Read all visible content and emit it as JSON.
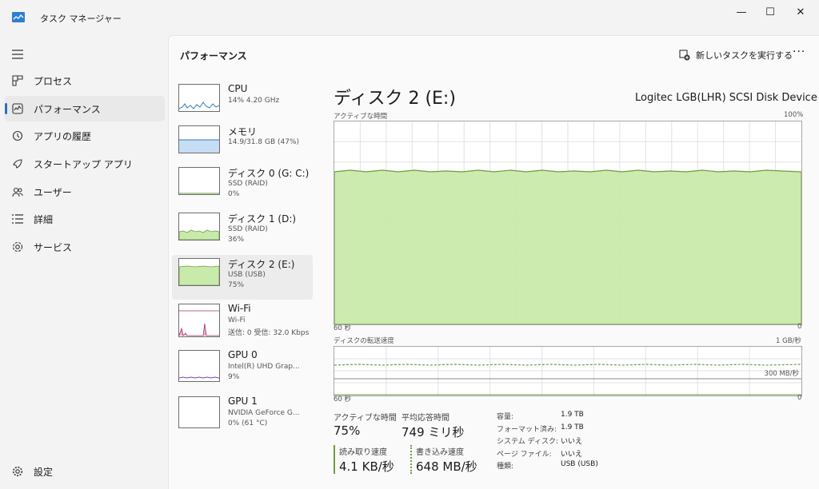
{
  "window": {
    "title": "タスク マネージャー",
    "controls": {
      "minimize": "—",
      "maximize": "☐",
      "close": "✕"
    }
  },
  "sidebar": {
    "menu_icon": "hamburger-icon",
    "items": [
      {
        "label": "プロセス",
        "icon": "processes-icon"
      },
      {
        "label": "パフォーマンス",
        "icon": "performance-icon"
      },
      {
        "label": "アプリの履歴",
        "icon": "history-icon"
      },
      {
        "label": "スタートアップ アプリ",
        "icon": "startup-icon"
      },
      {
        "label": "ユーザー",
        "icon": "users-icon"
      },
      {
        "label": "詳細",
        "icon": "details-icon"
      },
      {
        "label": "サービス",
        "icon": "services-icon"
      }
    ],
    "settings_label": "設定"
  },
  "header": {
    "title": "パフォーマンス",
    "new_task_label": "新しいタスクを実行する",
    "more_label": "···"
  },
  "devices": [
    {
      "name": "CPU",
      "sub1": "14%  4.20 GHz",
      "sub2": "",
      "sub3": "",
      "level": 0.14
    },
    {
      "name": "メモリ",
      "sub1": "14.9/31.8 GB (47%)",
      "sub2": "",
      "sub3": "",
      "level": 0.47
    },
    {
      "name": "ディスク 0 (G: C:)",
      "sub1": "SSD (RAID)",
      "sub2": "0%",
      "sub3": "",
      "level": 0.0
    },
    {
      "name": "ディスク 1 (D:)",
      "sub1": "SSD (RAID)",
      "sub2": "36%",
      "sub3": "",
      "level": 0.36
    },
    {
      "name": "ディスク 2 (E:)",
      "sub1": "USB (USB)",
      "sub2": "75%",
      "sub3": "",
      "level": 0.75
    },
    {
      "name": "Wi-Fi",
      "sub1": "Wi-Fi",
      "sub2": "送信: 0 受信: 32.0 Kbps",
      "sub3": "",
      "level": 0.1
    },
    {
      "name": "GPU 0",
      "sub1": "Intel(R) UHD Grap...",
      "sub2": "9%",
      "sub3": "",
      "level": 0.09
    },
    {
      "name": "GPU 1",
      "sub1": "NVIDIA GeForce G...",
      "sub2": "0% (61 °C)",
      "sub3": "",
      "level": 0.0
    }
  ],
  "detail": {
    "title": "ディスク 2 (E:)",
    "model": "Logitec LGB(LHR) SCSI Disk Device",
    "graph1": {
      "label": "アクティブな時間",
      "max": "100%",
      "time_left": "60 秒",
      "time_right": "0",
      "level": 0.75
    },
    "graph2": {
      "label": "ディスクの転送速度",
      "max": "1 GB/秒",
      "mid": "300 MB/秒",
      "time_left": "60 秒",
      "time_right": "0"
    },
    "stats": {
      "active_label": "アクティブな時間",
      "active_value": "75%",
      "resp_label": "平均応答時間",
      "resp_value": "749 ミリ秒",
      "read_label": "読み取り速度",
      "read_value": "4.1 KB/秒",
      "write_label": "書き込み速度",
      "write_value": "648 MB/秒"
    },
    "props": [
      {
        "key": "容量:",
        "value": "1.9 TB"
      },
      {
        "key": "フォーマット済み:",
        "value": "1.9 TB"
      },
      {
        "key": "システム ディスク:",
        "value": "いいえ"
      },
      {
        "key": "ページ ファイル:",
        "value": "いいえ"
      },
      {
        "key": "種類:",
        "value": "USB (USB)"
      }
    ]
  },
  "colors": {
    "disk_fill": "#c8eaab",
    "disk_line": "#6f9b45",
    "cpu_line": "#2e7db5",
    "mem_fill": "#c6ddf4",
    "wifi_line": "#a3306c",
    "gpu_line": "#7b3fb8",
    "accent": "#2f6fbd"
  }
}
